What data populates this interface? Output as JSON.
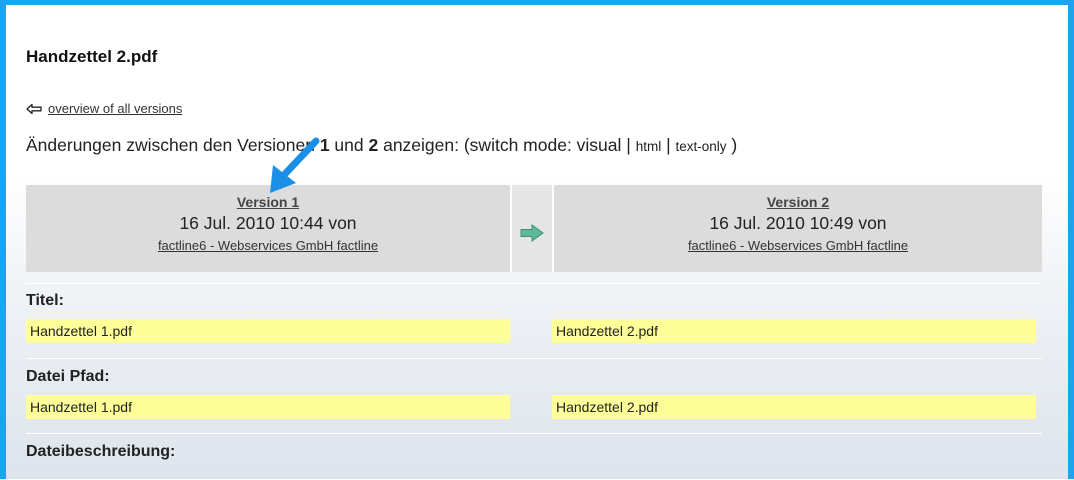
{
  "document": {
    "title": "Handzettel 2.pdf"
  },
  "navigation": {
    "back_icon": "back-arrow-icon",
    "overview_link": "overview of all versions"
  },
  "compare": {
    "prefix": "Änderungen zwischen den Versionen ",
    "version_a": "1",
    "middle": " und ",
    "version_b": "2",
    "suffix": " anzeigen: (switch mode: visual | ",
    "mode_html": "html",
    "mode_separator": " | ",
    "mode_text": "text-only",
    "close": " )"
  },
  "versions": {
    "left": {
      "label": "Version 1",
      "date": "16 Jul. 2010 10:44 von",
      "author": "factline6 - Webservices GmbH factline"
    },
    "arrow_icon": "right-arrow-icon",
    "right": {
      "label": "Version 2",
      "date": "16 Jul. 2010 10:49 von",
      "author": "factline6 - Webservices GmbH factline"
    }
  },
  "fields": {
    "titel": {
      "label": "Titel:",
      "old_value": "Handzettel 1.pdf",
      "new_value": "Handzettel 2.pdf"
    },
    "datei_pfad": {
      "label": "Datei Pfad:",
      "old_value": "Handzettel 1.pdf",
      "new_value": "Handzettel 2.pdf"
    },
    "dateibeschreibung": {
      "label": "Dateibeschreibung:"
    }
  },
  "colors": {
    "frame_border": "#1fa3f0",
    "highlight": "#ffff99",
    "version_header_bg": "#dcdcdc",
    "arrow_green": "#5fb89a",
    "annotation_arrow": "#1b8fe6"
  }
}
